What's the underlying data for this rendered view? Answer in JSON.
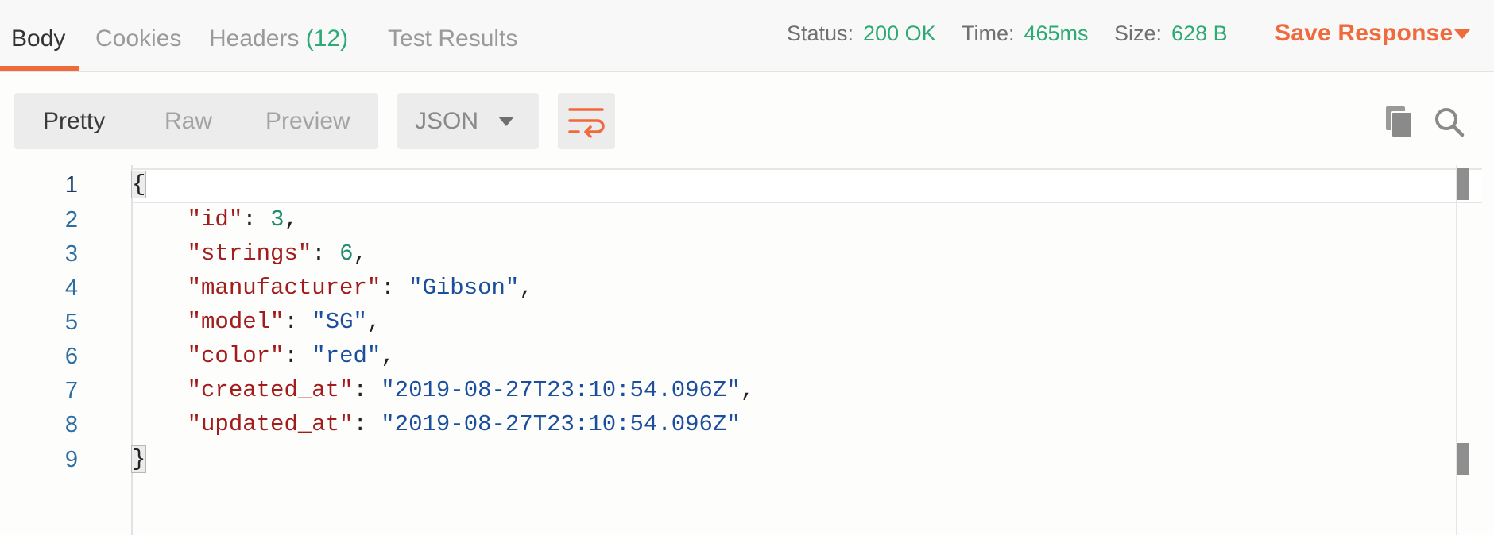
{
  "tabs": {
    "body": "Body",
    "cookies": "Cookies",
    "headers": "Headers",
    "headers_count": "(12)",
    "test_results": "Test Results"
  },
  "status": {
    "status_label": "Status:",
    "status_value": "200 OK",
    "time_label": "Time:",
    "time_value": "465ms",
    "size_label": "Size:",
    "size_value": "628 B"
  },
  "save_response": "Save Response",
  "view_modes": {
    "pretty": "Pretty",
    "raw": "Raw",
    "preview": "Preview",
    "selected": "Pretty"
  },
  "format": {
    "selected": "JSON"
  },
  "icons": {
    "wrap": "wrap-lines-icon",
    "copy": "copy-icon",
    "search": "search-icon"
  },
  "colors": {
    "accent": "#ef6a3c",
    "status_ok": "#2eaa74",
    "json_key": "#a11c1c",
    "json_string": "#1b4f9c",
    "json_number": "#1e8a6e"
  },
  "code": {
    "line_numbers": [
      "1",
      "2",
      "3",
      "4",
      "5",
      "6",
      "7",
      "8",
      "9"
    ],
    "open_brace": "{",
    "close_brace": "}",
    "fields": [
      {
        "key": "\"id\"",
        "value": "3",
        "type": "number",
        "comma": ","
      },
      {
        "key": "\"strings\"",
        "value": "6",
        "type": "number",
        "comma": ","
      },
      {
        "key": "\"manufacturer\"",
        "value": "\"Gibson\"",
        "type": "string",
        "comma": ","
      },
      {
        "key": "\"model\"",
        "value": "\"SG\"",
        "type": "string",
        "comma": ","
      },
      {
        "key": "\"color\"",
        "value": "\"red\"",
        "type": "string",
        "comma": ","
      },
      {
        "key": "\"created_at\"",
        "value": "\"2019-08-27T23:10:54.096Z\"",
        "type": "string",
        "comma": ","
      },
      {
        "key": "\"updated_at\"",
        "value": "\"2019-08-27T23:10:54.096Z\"",
        "type": "string",
        "comma": ""
      }
    ]
  }
}
